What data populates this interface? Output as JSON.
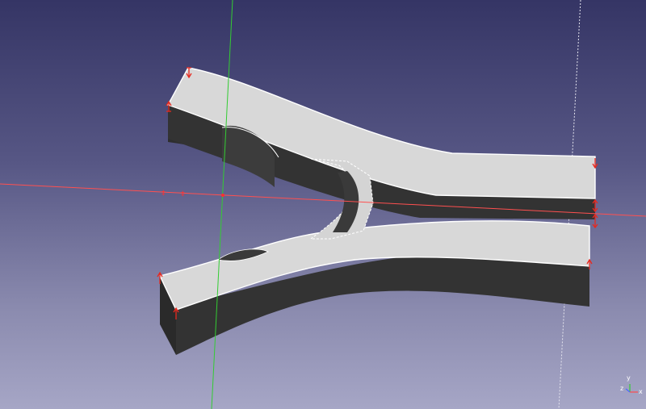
{
  "viewport": {
    "background_top": "#353565",
    "background_bottom": "#a6a6c6"
  },
  "colors": {
    "face_top": "#d8d8d8",
    "face_side_dark": "#2c2c2c",
    "face_side_mid": "#3a3a3a",
    "edge": "#ffffff",
    "x_axis": "#ff4a4a",
    "y_axis": "#33cc33",
    "z_axis_guide": "#dddddd",
    "constraint_arrow": "#e8281e"
  },
  "view_indicator": {
    "x_label": "x",
    "y_label": "y",
    "z_label": "z"
  },
  "icons": [
    "axis-cross-icon",
    "constraint-arrow-icon",
    "origin-point-icon"
  ]
}
